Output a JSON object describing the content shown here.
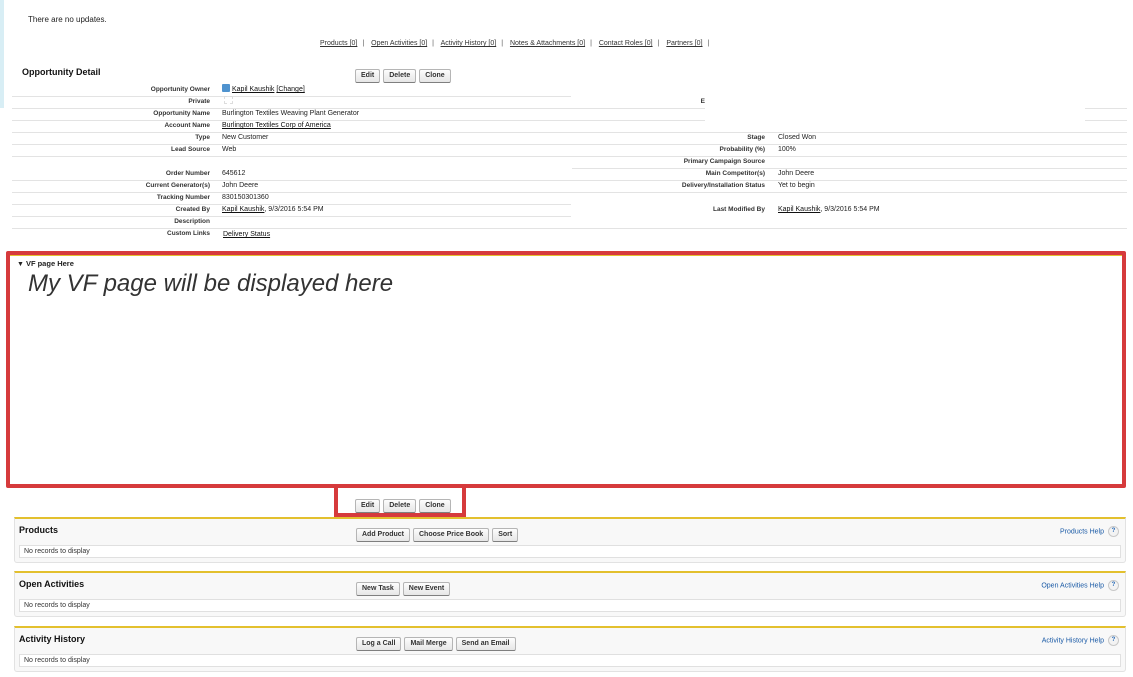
{
  "updates": {
    "text": "There are no updates."
  },
  "related_links": [
    {
      "label": "Products [0]"
    },
    {
      "label": "Open Activities [0]"
    },
    {
      "label": "Activity History [0]"
    },
    {
      "label": "Notes & Attachments [0]"
    },
    {
      "label": "Contact Roles [0]"
    },
    {
      "label": "Partners [0]"
    }
  ],
  "detail": {
    "title": "Opportunity Detail",
    "buttons": {
      "edit": "Edit",
      "delete": "Delete",
      "clone": "Clone"
    },
    "left_fields": [
      {
        "label": "Opportunity Owner",
        "value": "Kapil Kaushik",
        "extra": "[Change]"
      },
      {
        "label": "Private",
        "value": ""
      },
      {
        "label": "Opportunity Name",
        "value": "Burlington Textiles Weaving Plant Generator"
      },
      {
        "label": "Account Name",
        "value": "Burlington Textiles Corp of America"
      },
      {
        "label": "Type",
        "value": "New Customer"
      },
      {
        "label": "Lead Source",
        "value": "Web"
      },
      {
        "label": "Order Number",
        "value": "645612"
      },
      {
        "label": "Current Generator(s)",
        "value": "John Deere"
      },
      {
        "label": "Tracking Number",
        "value": "830150301360"
      },
      {
        "label": "Created By",
        "value": "Kapil Kaushik",
        "extra": ", 9/3/2016 5:54 PM"
      },
      {
        "label": "Description",
        "value": ""
      },
      {
        "label": "Custom Links",
        "value": "Delivery Status"
      }
    ],
    "right_fields": [
      {
        "label": "Stage",
        "value": "Closed Won"
      },
      {
        "label": "Probability (%)",
        "value": "100%"
      },
      {
        "label": "Primary Campaign Source",
        "value": ""
      },
      {
        "label": "Main Competitor(s)",
        "value": "John Deere"
      },
      {
        "label": "Delivery/Installation Status",
        "value": "Yet to begin"
      },
      {
        "label": "Last Modified By",
        "value": "Kapil Kaushik",
        "extra": ", 9/3/2016 5:54 PM"
      }
    ],
    "cropped_label_fragment": "E"
  },
  "vf_section": {
    "header": "VF page Here",
    "body_text": "My VF page will be displayed here"
  },
  "bottom_buttons": {
    "edit": "Edit",
    "delete": "Delete",
    "clone": "Clone"
  },
  "related_lists": [
    {
      "title": "Products",
      "buttons": [
        "Add Product",
        "Choose Price Book",
        "Sort"
      ],
      "help": "Products Help",
      "empty_text": "No records to display"
    },
    {
      "title": "Open Activities",
      "buttons": [
        "New Task",
        "New Event"
      ],
      "help": "Open Activities Help",
      "empty_text": "No records to display"
    },
    {
      "title": "Activity History",
      "buttons": [
        "Log a Call",
        "Mail Merge",
        "Send an Email"
      ],
      "help": "Activity History Help",
      "empty_text": "No records to display"
    }
  ],
  "colors": {
    "annotation_red": "#d63a3c",
    "section_accent": "#e3c02e",
    "help_link": "#1a5aa6"
  }
}
